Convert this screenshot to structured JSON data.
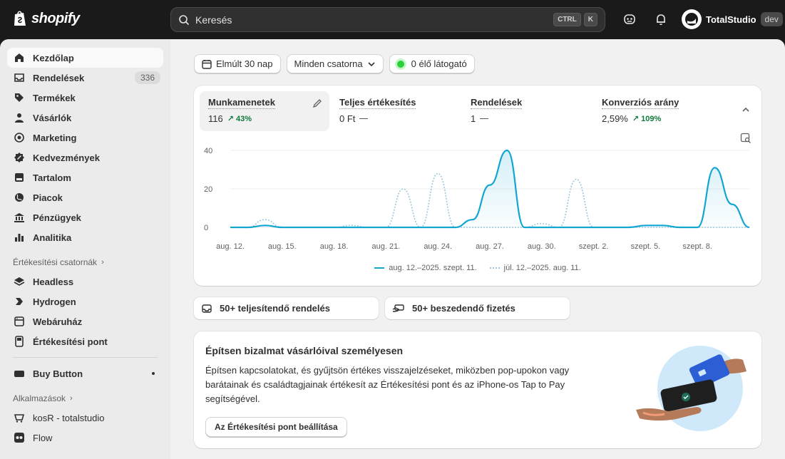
{
  "topbar": {
    "logo_text": "shopify",
    "search_placeholder": "Keresés",
    "kbd1": "CTRL",
    "kbd2": "K",
    "store_name": "TotalStudio",
    "store_badge": "dev"
  },
  "sidebar": {
    "items": [
      {
        "label": "Kezdőlap",
        "icon": "home-icon"
      },
      {
        "label": "Rendelések",
        "icon": "orders-icon",
        "badge": "336"
      },
      {
        "label": "Termékek",
        "icon": "tag-icon"
      },
      {
        "label": "Vásárlók",
        "icon": "person-icon"
      },
      {
        "label": "Marketing",
        "icon": "target-icon"
      },
      {
        "label": "Kedvezmények",
        "icon": "discount-icon"
      },
      {
        "label": "Tartalom",
        "icon": "content-icon"
      },
      {
        "label": "Piacok",
        "icon": "globe-icon"
      },
      {
        "label": "Pénzügyek",
        "icon": "bank-icon"
      },
      {
        "label": "Analitika",
        "icon": "chart-icon"
      }
    ],
    "channels_heading": "Értékesítési csatornák",
    "channels": [
      {
        "label": "Headless",
        "icon": "layers-icon"
      },
      {
        "label": "Hydrogen",
        "icon": "hydrogen-icon"
      },
      {
        "label": "Webáruház",
        "icon": "store-icon"
      },
      {
        "label": "Értékesítési pont",
        "icon": "pos-icon"
      }
    ],
    "buy_button": "Buy Button",
    "apps_heading": "Alkalmazások",
    "apps": [
      {
        "label": "kosR - totalstudio",
        "icon": "app-icon"
      },
      {
        "label": "Flow",
        "icon": "flow-icon"
      }
    ]
  },
  "filters": {
    "date": "Elmúlt 30 nap",
    "channel": "Minden csatorna",
    "live": "0 élő látogató"
  },
  "metrics": [
    {
      "label": "Munkamenetek",
      "value": "116",
      "change": "43%"
    },
    {
      "label": "Teljes értékesítés",
      "value": "0 Ft"
    },
    {
      "label": "Rendelések",
      "value": "1"
    },
    {
      "label": "Konverziós arány",
      "value": "2,59%",
      "change": "109%"
    }
  ],
  "chart_data": {
    "type": "line",
    "x": [
      "aug. 12.",
      "aug. 13.",
      "aug. 14.",
      "aug. 15.",
      "aug. 16.",
      "aug. 17.",
      "aug. 18.",
      "aug. 19.",
      "aug. 20.",
      "aug. 21.",
      "aug. 22.",
      "aug. 23.",
      "aug. 24.",
      "aug. 25.",
      "aug. 26.",
      "aug. 27.",
      "aug. 28.",
      "aug. 29.",
      "aug. 30.",
      "aug. 31.",
      "szept. 1.",
      "szept. 2.",
      "szept. 3.",
      "szept. 4.",
      "szept. 5.",
      "szept. 6.",
      "szept. 7.",
      "szept. 8.",
      "szept. 9.",
      "szept. 10.",
      "szept. 11."
    ],
    "tick_labels": [
      "aug. 12.",
      "aug. 15.",
      "aug. 18.",
      "aug. 21.",
      "aug. 24.",
      "aug. 27.",
      "aug. 30.",
      "szept. 2.",
      "szept. 5.",
      "szept. 8."
    ],
    "y_ticks": [
      "0",
      "20",
      "40"
    ],
    "ylim": [
      0,
      40
    ],
    "series": [
      {
        "name": "aug. 12.–2025. szept. 11.",
        "style": "solid",
        "values": [
          0,
          0,
          1,
          0,
          0,
          0,
          0,
          0,
          0,
          0,
          0,
          0,
          0,
          0,
          4,
          22,
          40,
          0,
          0,
          0,
          0,
          0,
          0,
          0,
          1,
          1,
          0,
          0,
          31,
          12,
          0
        ]
      },
      {
        "name": "júl. 12.–2025. aug. 11.",
        "style": "dotted",
        "values": [
          0,
          0,
          4,
          0,
          0,
          0,
          0,
          1,
          0,
          0,
          20,
          0,
          28,
          0,
          0,
          0,
          0,
          0,
          2,
          0,
          25,
          0,
          0,
          0,
          0,
          0,
          0,
          0,
          0,
          0,
          0
        ]
      }
    ],
    "colors": {
      "current": "#13a6d3",
      "previous": "#9cc8dc"
    }
  },
  "tasks": {
    "orders": "50+ teljesítendő rendelés",
    "payments": "50+ beszedendő fizetés"
  },
  "promo": {
    "title": "Építsen bizalmat vásárlóival személyesen",
    "body": "Építsen kapcsolatokat, és gyűjtsön értékes visszajelzéseket, miközben pop-upokon vagy barátainak és családtagjainak értékesít az Értékesítési pont és az iPhone-os Tap to Pay segítségével.",
    "button": "Az Értékesítési pont beállítása"
  }
}
